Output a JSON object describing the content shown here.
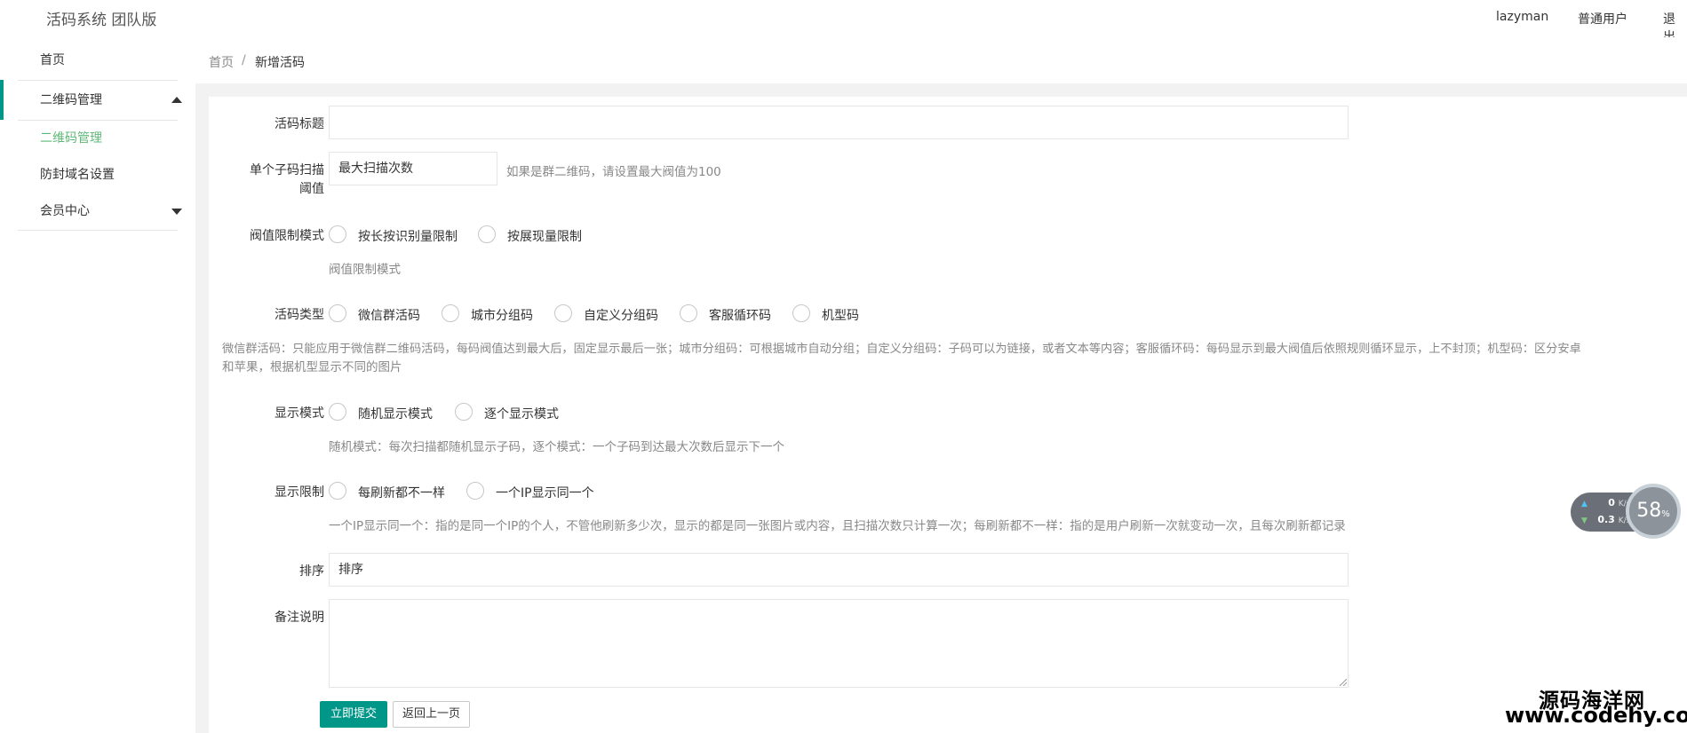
{
  "header": {
    "logo": "活码系统 团队版",
    "username": "lazyman",
    "role": "普通用户",
    "logout": "退出"
  },
  "sidebar": {
    "home": "首页",
    "qr_group": "二维码管理",
    "qr_sub": "二维码管理",
    "anti_block": "防封域名设置",
    "member": "会员中心"
  },
  "breadcrumb": {
    "home": "首页",
    "sep": "/",
    "current": "新增活码"
  },
  "form": {
    "title_label": "活码标题",
    "title_value": "",
    "threshold_label_1": "单个子码扫描",
    "threshold_label_2": "阈值",
    "threshold_placeholder": "最大扫描次数",
    "threshold_help": "如果是群二维码，请设置最大阀值为100",
    "limit_mode_label": "阀值限制模式",
    "limit_mode_options": [
      "按长按识别量限制",
      "按展现量限制"
    ],
    "limit_mode_help": "阀值限制模式",
    "type_label": "活码类型",
    "type_options": [
      "微信群活码",
      "城市分组码",
      "自定义分组码",
      "客服循环码",
      "机型码"
    ],
    "type_help_1": "微信群活码：只能应用于微信群二维码活码，每码阀值达到最大后，固定显示最后一张；城市分组码：可根据城市自动分组；自定义分组码：子码可以为链接，或者文本等内容；客服循环码：每码显示到最大阀值后依照规则循环显示，上不封顶；机型码：区分安卓",
    "type_help_2": "和苹果，根据机型显示不同的图片",
    "display_mode_label": "显示模式",
    "display_mode_options": [
      "随机显示模式",
      "逐个显示模式"
    ],
    "display_mode_help": "随机模式：每次扫描都随机显示子码，逐个模式：一个子码到达最大次数后显示下一个",
    "display_limit_label": "显示限制",
    "display_limit_options": [
      "每刷新都不一样",
      "一个IP显示同一个"
    ],
    "display_limit_help": "一个IP显示同一个：指的是同一个IP的个人，不管他刷新多少次，显示的都是同一张图片或内容，且扫描次数只计算一次；每刷新都不一样：指的是用户刷新一次就变动一次，且每次刷新都记录",
    "sort_label": "排序",
    "sort_placeholder": "排序",
    "remark_label": "备注说明",
    "submit": "立即提交",
    "back": "返回上一页"
  },
  "netwidget": {
    "up_value": "0",
    "up_unit": "K/s",
    "down_value": "0.3",
    "down_unit": "K/s",
    "percent": "58",
    "percent_unit": "%"
  },
  "watermark": {
    "line1": "源码海洋网",
    "line2": "www.codehy.com"
  },
  "colors": {
    "accent": "#009688",
    "active_text": "#5FB878"
  }
}
